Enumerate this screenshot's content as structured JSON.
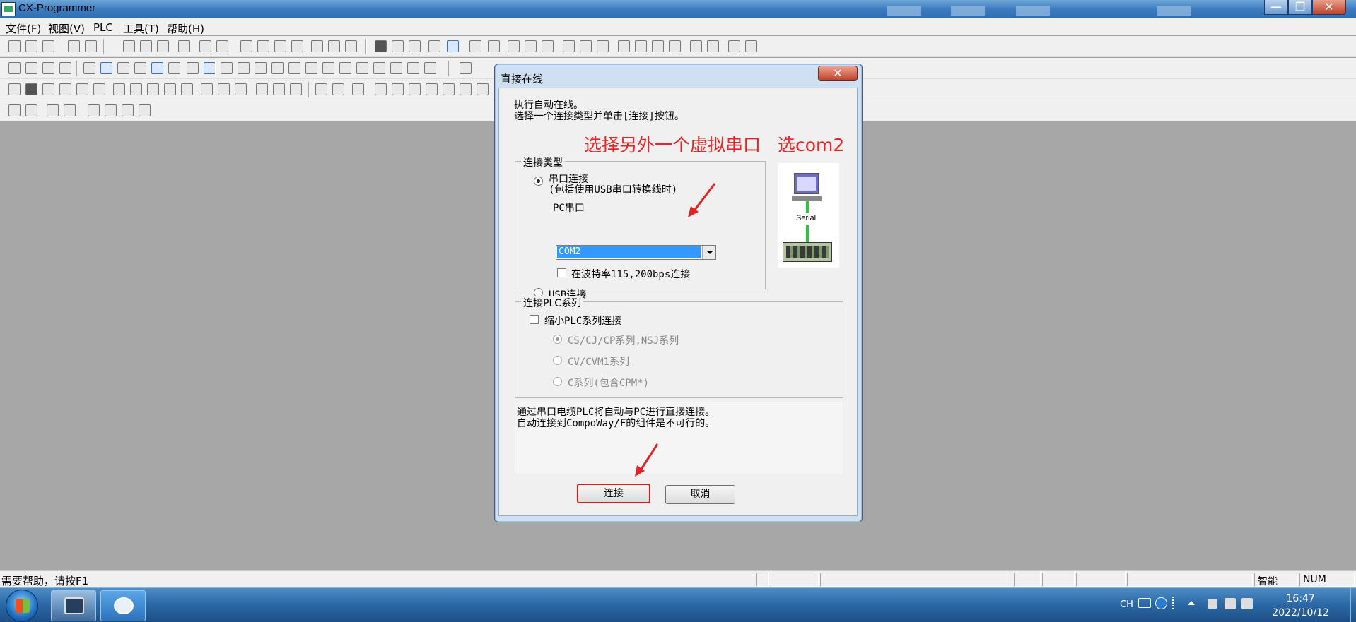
{
  "window": {
    "title": "CX-Programmer",
    "min": "—",
    "max": "❐",
    "close": "✕"
  },
  "menu": [
    "文件(F)",
    "视图(V)",
    "PLC",
    "工具(T)",
    "帮助(H)"
  ],
  "dialog": {
    "title": "直接在线",
    "close": "✕",
    "intro": [
      "执行自动在线。",
      "选择一个连接类型并单击[连接]按钮。"
    ],
    "annotation_left": "选择另外一个虚拟串口",
    "annotation_right": "选com2",
    "connection_type": {
      "legend": "连接类型",
      "serial_label": "串口连接",
      "serial_note": "(包括使用USB串口转换线时)",
      "pc_port_label": "PC串口",
      "port_value": "COM2",
      "baud_label": "在波特率115,200bps连接",
      "usb_label": "USB连接",
      "selected": "serial"
    },
    "diagram_label": "Serial",
    "plc_series": {
      "legend": "连接PLC系列",
      "narrow_label": "缩小PLC系列连接",
      "options": [
        "CS/CJ/CP系列,NSJ系列",
        "CV/CVM1系列",
        "C系列(包含CPM*)"
      ]
    },
    "info": [
      "通过串口电缆PLC将自动与PC进行直接连接。",
      "自动连接到CompoWay/F的组件是不可行的。"
    ],
    "connect_label": "连接",
    "cancel_label": "取消"
  },
  "status": {
    "help": "需要帮助，请按F1",
    "mode": "智能",
    "num": "NUM"
  },
  "taskbar": {
    "lang": "CH",
    "time": "16:47",
    "date": "2022/10/12"
  },
  "colors": {
    "annotation": "#e22222",
    "selection": "#3399ff"
  }
}
